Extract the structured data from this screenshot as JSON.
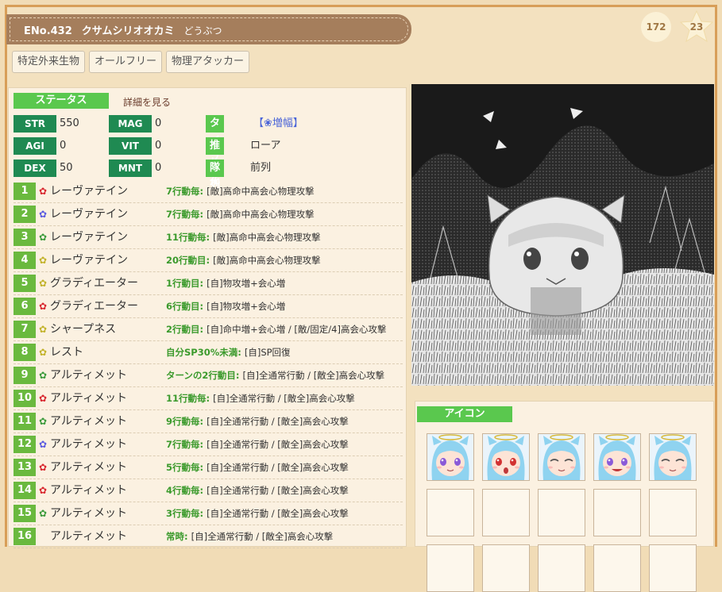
{
  "header": {
    "eno": "ENo.432",
    "name": "クサムシリオオカミ",
    "species": "どうぶつ",
    "badge_count": "172",
    "star_count": "23"
  },
  "tags": [
    "特定外来生物",
    "オールフリー",
    "物理アタッカー"
  ],
  "status": {
    "label": "ステータス",
    "detail_link": "詳細を見る",
    "stats": [
      {
        "label": "STR",
        "value": "550"
      },
      {
        "label": "AGI",
        "value": "0"
      },
      {
        "label": "DEX",
        "value": "50"
      },
      {
        "label": "MAG",
        "value": "0"
      },
      {
        "label": "VIT",
        "value": "0"
      },
      {
        "label": "MNT",
        "value": "0"
      }
    ],
    "attrs": [
      {
        "label": "タイプ",
        "value": "【❀増幅】"
      },
      {
        "label": "推し花",
        "value": "ローア"
      },
      {
        "label": "隊列",
        "value": "前列"
      }
    ]
  },
  "skills": [
    {
      "num": "1",
      "flower": "red",
      "name": "レーヴァテイン",
      "cond": "7行動毎:",
      "effect": "[敵]高命中高会心物理攻撃"
    },
    {
      "num": "2",
      "flower": "blue",
      "name": "レーヴァテイン",
      "cond": "7行動毎:",
      "effect": "[敵]高命中高会心物理攻撃"
    },
    {
      "num": "3",
      "flower": "green",
      "name": "レーヴァテイン",
      "cond": "11行動毎:",
      "effect": "[敵]高命中高会心物理攻撃"
    },
    {
      "num": "4",
      "flower": "yellow",
      "name": "レーヴァテイン",
      "cond": "20行動目:",
      "effect": "[敵]高命中高会心物理攻撃"
    },
    {
      "num": "5",
      "flower": "yellow",
      "name": "グラディエーター",
      "cond": "1行動目:",
      "effect": "[自]物攻増+会心増"
    },
    {
      "num": "6",
      "flower": "red",
      "name": "グラディエーター",
      "cond": "6行動目:",
      "effect": "[自]物攻増+会心増"
    },
    {
      "num": "7",
      "flower": "yellow",
      "name": "シャープネス",
      "cond": "2行動目:",
      "effect": "[自]命中増+会心増 / [敵/固定/4]高会心攻撃"
    },
    {
      "num": "8",
      "flower": "yellow",
      "name": "レスト",
      "cond": "自分SP30%未満:",
      "effect": "[自]SP回復"
    },
    {
      "num": "9",
      "flower": "green",
      "name": "アルティメット",
      "cond": "ターンの2行動目:",
      "effect": "[自]全通常行動 / [敵全]高会心攻撃"
    },
    {
      "num": "10",
      "flower": "red",
      "name": "アルティメット",
      "cond": "11行動毎:",
      "effect": "[自]全通常行動 / [敵全]高会心攻撃"
    },
    {
      "num": "11",
      "flower": "green",
      "name": "アルティメット",
      "cond": "9行動毎:",
      "effect": "[自]全通常行動 / [敵全]高会心攻撃"
    },
    {
      "num": "12",
      "flower": "blue",
      "name": "アルティメット",
      "cond": "7行動毎:",
      "effect": "[自]全通常行動 / [敵全]高会心攻撃"
    },
    {
      "num": "13",
      "flower": "red",
      "name": "アルティメット",
      "cond": "5行動毎:",
      "effect": "[自]全通常行動 / [敵全]高会心攻撃"
    },
    {
      "num": "14",
      "flower": "red",
      "name": "アルティメット",
      "cond": "4行動毎:",
      "effect": "[自]全通常行動 / [敵全]高会心攻撃"
    },
    {
      "num": "15",
      "flower": "green",
      "name": "アルティメット",
      "cond": "3行動毎:",
      "effect": "[自]全通常行動 / [敵全]高会心攻撃"
    },
    {
      "num": "16",
      "flower": "none",
      "name": "アルティメット",
      "cond": "常時:",
      "effect": "[自]全通常行動 / [敵全]高会心攻撃"
    }
  ],
  "icons": {
    "label": "アイコン",
    "filled_count": 5,
    "expressions": [
      "neutral",
      "surprised",
      "happy",
      "grin",
      "sleepy"
    ]
  },
  "colors": {
    "red": "#d8262e",
    "blue": "#5a5ae0",
    "yellow": "#c2b22a",
    "green": "#3a9a3a",
    "stat_label": "#1f8a52",
    "section_label": "#5ac84e",
    "skill_number": "#6ab93e"
  }
}
